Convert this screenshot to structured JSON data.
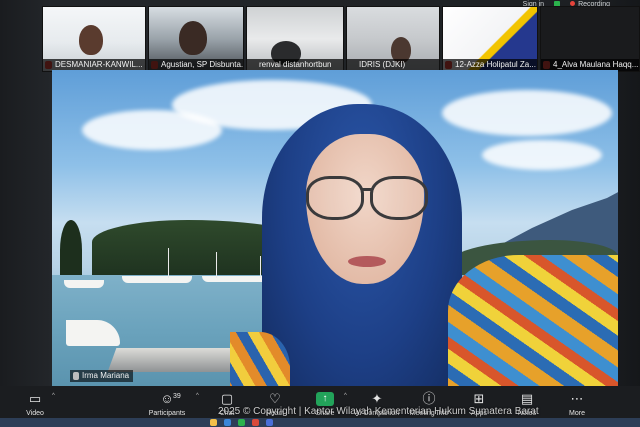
{
  "status": {
    "signin": "Sign in",
    "recording": "Recording"
  },
  "participants": [
    {
      "name": "DESMANIAR-KANWIL..."
    },
    {
      "name": "Agustian, SP Disbunta..."
    },
    {
      "name": "renval distanhortbun"
    },
    {
      "name": "IDRIS (DJKI)"
    },
    {
      "name": "12-Azza Holipatul Za..."
    },
    {
      "name": "4_Alva Maulana Haqq..."
    }
  ],
  "speaker": {
    "name": "Irma Mariana"
  },
  "toolbar": {
    "video": "Video",
    "participants": "Participants",
    "participants_count": "39",
    "chat": "Chat",
    "react": "React",
    "share": "Share",
    "ai_companion": "AI Companion",
    "meeting_info": "Meeting Info",
    "apps": "Apps",
    "notes": "Notes",
    "more": "More"
  },
  "watermark": "2025 © Copyright | Kantor Wilayah Kementerian Hukum Sumatera Barat",
  "colors": {
    "recording": "#e5443b",
    "share": "#22a35a",
    "toolbar": "#1b1d20"
  },
  "icons": [
    "video-icon",
    "participants-icon",
    "chat-icon",
    "react-icon",
    "share-icon",
    "ai-companion-icon",
    "info-icon",
    "apps-icon",
    "notes-icon",
    "more-icon"
  ]
}
